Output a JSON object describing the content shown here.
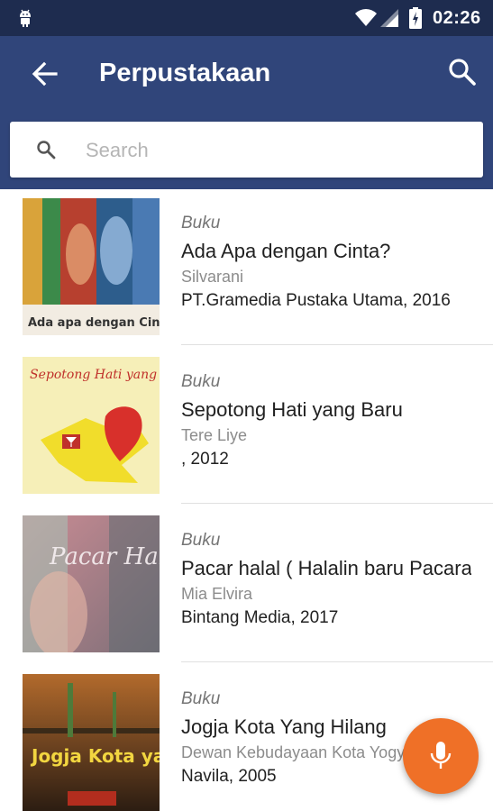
{
  "status_bar": {
    "time": "02:26"
  },
  "app_bar": {
    "title": "Perpustakaan"
  },
  "search": {
    "placeholder": "Search"
  },
  "books": [
    {
      "type": "Buku",
      "title": "Ada Apa dengan Cinta?",
      "author": "Silvarani",
      "publisher": "PT.Gramedia Pustaka Utama, 2016",
      "cover_text": "Ada apa dengan Cinta?"
    },
    {
      "type": "Buku",
      "title": "Sepotong Hati yang Baru",
      "author": "Tere Liye",
      "publisher": ", 2012",
      "cover_text": "Sepotong Hati yang Baru"
    },
    {
      "type": "Buku",
      "title": "Pacar halal ( Halalin baru Pacaran )",
      "author": "Mia Elvira",
      "publisher": "Bintang Media, 2017",
      "cover_text": "Pacar Halal"
    },
    {
      "type": "Buku",
      "title": "Jogja Kota Yang Hilang",
      "author": "Dewan Kebudayaan Kota Yogyakarta",
      "publisher": "Navila, 2005",
      "cover_text": "Jogja Kota yang Hilang"
    }
  ],
  "colors": {
    "status_bar": "#1e2c4f",
    "app_bar": "#30457a",
    "fab": "#ef7027"
  },
  "icons": {
    "back": "arrow-back-icon",
    "search": "search-icon",
    "mic": "microphone-icon"
  }
}
